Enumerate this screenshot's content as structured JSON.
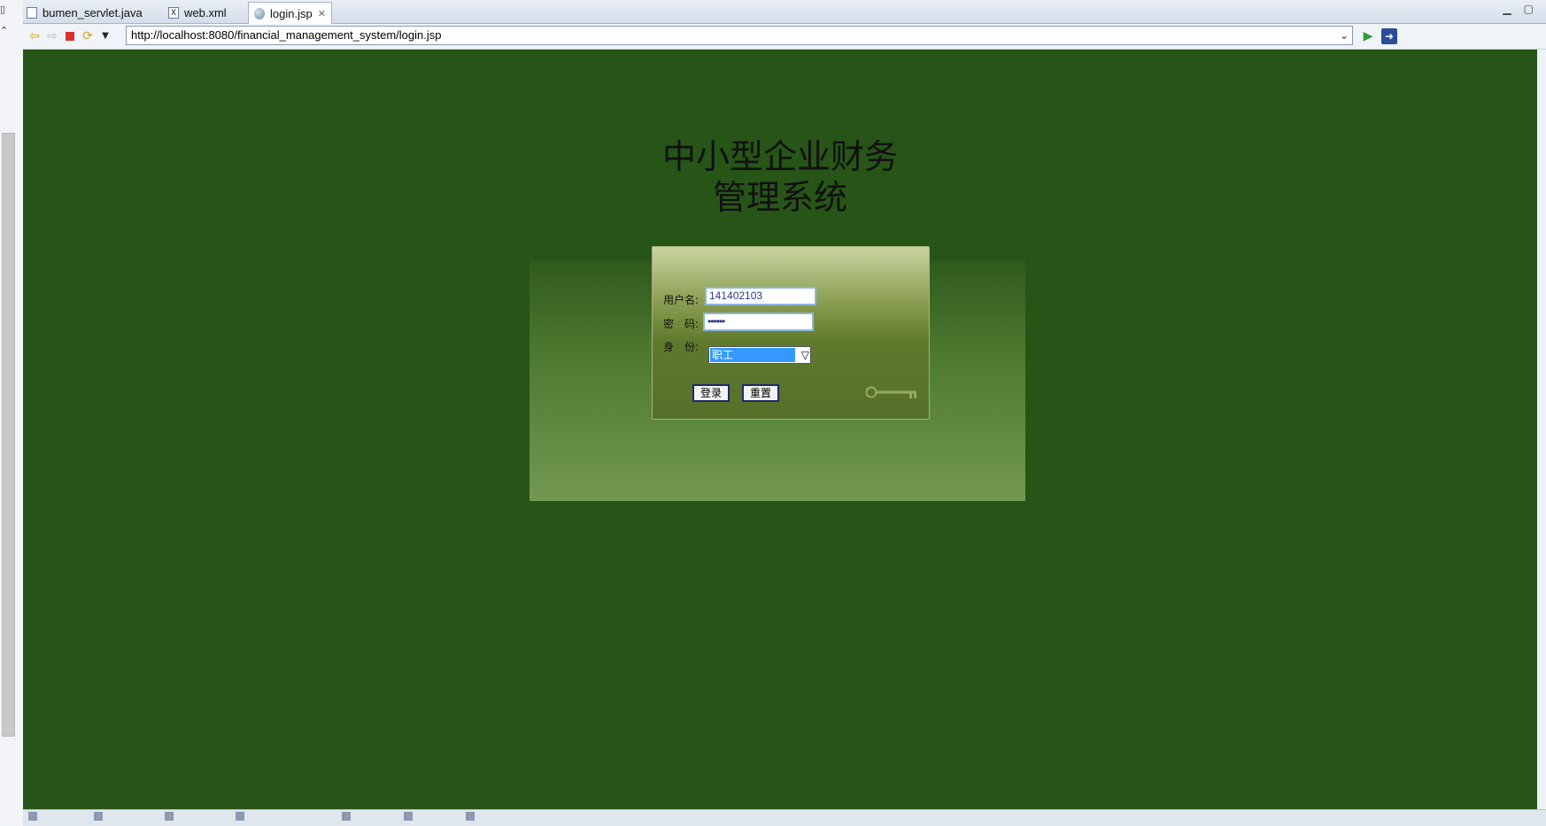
{
  "tabs": [
    {
      "label": "bumen_servlet.java",
      "icon": "java-file-icon",
      "active": false
    },
    {
      "label": "web.xml",
      "icon": "xml-file-icon",
      "active": false
    },
    {
      "label": "login.jsp",
      "icon": "globe-icon",
      "active": true
    }
  ],
  "toolbar": {
    "url": "http://localhost:8080/financial_management_system/login.jsp"
  },
  "page": {
    "title_line1": "中小型企业财务",
    "title_line2": "管理系统",
    "username_label": "用户名:",
    "username_value": "141402103",
    "password_label": "密　码:",
    "password_value": "••••••",
    "role_label": "身　份:",
    "role_value": "职工",
    "login_button": "登录",
    "reset_button": "重置"
  },
  "colors": {
    "page_background": "#275417",
    "panel_top": "#c9d3a0",
    "panel_bottom": "#55702a",
    "selection_blue": "#3399ff"
  }
}
